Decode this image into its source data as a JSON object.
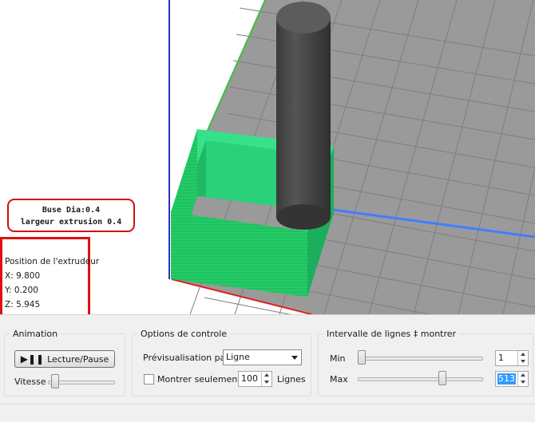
{
  "nozzle_info": {
    "line1": "Buse Dia:0.4",
    "line2": "largeur extrusion 0.4"
  },
  "extruder_position": {
    "title": "Position de l'extrudeur",
    "x": "X: 9.800",
    "y": "Y: 0.200",
    "z": "Z: 5.945"
  },
  "animation": {
    "legend": "Animation",
    "play_pause_label": "Lecture/Pause",
    "speed_label": "Vitesse",
    "speed_level": 0.05
  },
  "control_options": {
    "legend": "Options de controle",
    "preview_label": "Prévisualisation par",
    "preview_selected": "Ligne",
    "show_only_label": "Montrer seulement",
    "show_only_checked": false,
    "show_only_count": "100",
    "lines_label": "Lignes"
  },
  "line_range": {
    "legend": "Intervalle de lignes ‡ montrer",
    "min_label": "Min",
    "min_value": "1",
    "min_level": 0.0,
    "max_label": "Max",
    "max_value": "513",
    "max_level": 0.69
  },
  "colors": {
    "bed": "#9a9a9a",
    "grid": "#7f7f7f",
    "part": "#22cc66",
    "nozzle": "#474747",
    "axis_x": "#e02020",
    "axis_y": "#3f7fff",
    "axis_z": "#2f2fbf",
    "highlight": "#e01010"
  }
}
